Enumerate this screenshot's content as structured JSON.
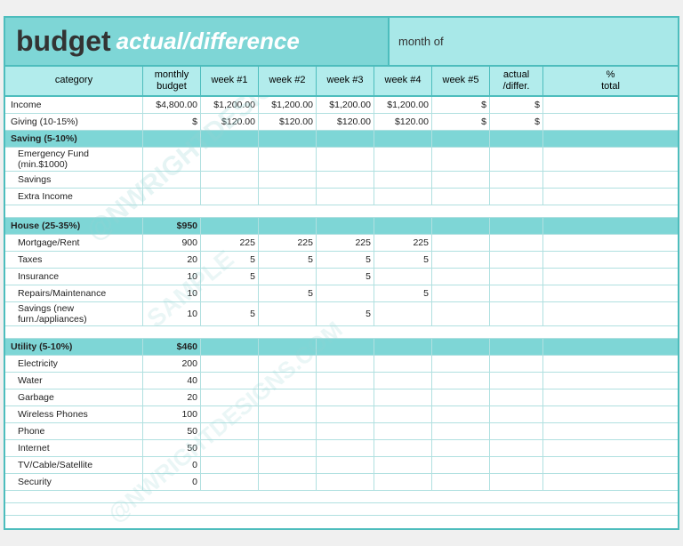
{
  "header": {
    "title_budget": "budget",
    "title_actual": "actual/difference",
    "month_label": "month of"
  },
  "columns": {
    "category": "category",
    "monthly_budget": "monthly\nbudget",
    "week1": "week #1",
    "week2": "week #2",
    "week3": "week #3",
    "week4": "week #4",
    "week5": "week #5",
    "actual_differ": "actual\n/differ.",
    "pct_total": "%\ntotal"
  },
  "sections": [
    {
      "type": "data",
      "category": "Income",
      "monthly": "$4,800.00",
      "week1": "$1,200.00",
      "week2": "$1,200.00",
      "week3": "$1,200.00",
      "week4": "$1,200.00",
      "week5": "$",
      "actual": "$",
      "pct": ""
    },
    {
      "type": "data",
      "category": "Giving (10-15%)",
      "monthly": "$",
      "week1": "$120.00",
      "week2": "$120.00",
      "week3": "$120.00",
      "week4": "$120.00",
      "week5": "$",
      "actual": "$",
      "pct": ""
    },
    {
      "type": "section",
      "category": "Saving (5-10%)",
      "monthly": "",
      "week1": "",
      "week2": "",
      "week3": "",
      "week4": "",
      "week5": "",
      "actual": "",
      "pct": ""
    },
    {
      "type": "data",
      "indent": true,
      "category": "Emergency Fund (min.$1000)",
      "monthly": "",
      "week1": "",
      "week2": "",
      "week3": "",
      "week4": "",
      "week5": "",
      "actual": "",
      "pct": ""
    },
    {
      "type": "data",
      "indent": true,
      "category": "Savings",
      "monthly": "",
      "week1": "",
      "week2": "",
      "week3": "",
      "week4": "",
      "week5": "",
      "actual": "",
      "pct": ""
    },
    {
      "type": "data",
      "indent": true,
      "category": "Extra Income",
      "monthly": "",
      "week1": "",
      "week2": "",
      "week3": "",
      "week4": "",
      "week5": "",
      "actual": "",
      "pct": ""
    },
    {
      "type": "spacer"
    },
    {
      "type": "section",
      "category": "House (25-35%)",
      "monthly": "$950",
      "week1": "",
      "week2": "",
      "week3": "",
      "week4": "",
      "week5": "",
      "actual": "",
      "pct": ""
    },
    {
      "type": "data",
      "indent": true,
      "category": "Mortgage/Rent",
      "monthly": "900",
      "week1": "225",
      "week2": "225",
      "week3": "225",
      "week4": "225",
      "week5": "",
      "actual": "",
      "pct": ""
    },
    {
      "type": "data",
      "indent": true,
      "category": "Taxes",
      "monthly": "20",
      "week1": "5",
      "week2": "5",
      "week3": "5",
      "week4": "5",
      "week5": "",
      "actual": "",
      "pct": ""
    },
    {
      "type": "data",
      "indent": true,
      "category": "Insurance",
      "monthly": "10",
      "week1": "5",
      "week2": "",
      "week3": "5",
      "week4": "",
      "week5": "",
      "actual": "",
      "pct": ""
    },
    {
      "type": "data",
      "indent": true,
      "category": "Repairs/Maintenance",
      "monthly": "10",
      "week1": "",
      "week2": "5",
      "week3": "",
      "week4": "5",
      "week5": "",
      "actual": "",
      "pct": ""
    },
    {
      "type": "data",
      "indent": true,
      "category": "Savings (new furn./appliances)",
      "monthly": "10",
      "week1": "5",
      "week2": "",
      "week3": "5",
      "week4": "",
      "week5": "",
      "actual": "",
      "pct": ""
    },
    {
      "type": "spacer"
    },
    {
      "type": "section",
      "category": "Utility (5-10%)",
      "monthly": "$460",
      "week1": "",
      "week2": "",
      "week3": "",
      "week4": "",
      "week5": "",
      "actual": "",
      "pct": ""
    },
    {
      "type": "data",
      "indent": true,
      "category": "Electricity",
      "monthly": "200",
      "week1": "",
      "week2": "",
      "week3": "",
      "week4": "",
      "week5": "",
      "actual": "",
      "pct": ""
    },
    {
      "type": "data",
      "indent": true,
      "category": "Water",
      "monthly": "40",
      "week1": "",
      "week2": "",
      "week3": "",
      "week4": "",
      "week5": "",
      "actual": "",
      "pct": ""
    },
    {
      "type": "data",
      "indent": true,
      "category": "Garbage",
      "monthly": "20",
      "week1": "",
      "week2": "",
      "week3": "",
      "week4": "",
      "week5": "",
      "actual": "",
      "pct": ""
    },
    {
      "type": "data",
      "indent": true,
      "category": "Wireless Phones",
      "monthly": "100",
      "week1": "",
      "week2": "",
      "week3": "",
      "week4": "",
      "week5": "",
      "actual": "",
      "pct": ""
    },
    {
      "type": "data",
      "indent": true,
      "category": "Phone",
      "monthly": "50",
      "week1": "",
      "week2": "",
      "week3": "",
      "week4": "",
      "week5": "",
      "actual": "",
      "pct": ""
    },
    {
      "type": "data",
      "indent": true,
      "category": "Internet",
      "monthly": "50",
      "week1": "",
      "week2": "",
      "week3": "",
      "week4": "",
      "week5": "",
      "actual": "",
      "pct": ""
    },
    {
      "type": "data",
      "indent": true,
      "category": "TV/Cable/Satellite",
      "monthly": "0",
      "week1": "",
      "week2": "",
      "week3": "",
      "week4": "",
      "week5": "",
      "actual": "",
      "pct": ""
    },
    {
      "type": "data",
      "indent": true,
      "category": "Security",
      "monthly": "0",
      "week1": "",
      "week2": "",
      "week3": "",
      "week4": "",
      "week5": "",
      "actual": "",
      "pct": ""
    },
    {
      "type": "spacer"
    },
    {
      "type": "spacer"
    },
    {
      "type": "spacer"
    }
  ]
}
